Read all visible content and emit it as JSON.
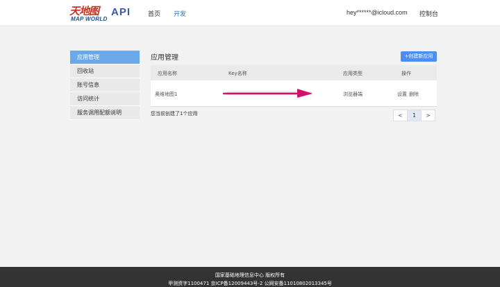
{
  "header": {
    "logo_cn": "天地图",
    "logo_en": "MAP WORLD",
    "api_title": "API",
    "nav_home": "首页",
    "nav_dev": "开发",
    "email": "hey******@icloud.com",
    "console": "控制台"
  },
  "sidebar": {
    "items": [
      {
        "label": "应用管理"
      },
      {
        "label": "回收站"
      },
      {
        "label": "账号信息"
      },
      {
        "label": "访问统计"
      },
      {
        "label": "服务调用配额说明"
      }
    ]
  },
  "main": {
    "title": "应用管理",
    "create_label": "+创建新应用",
    "columns": [
      "应用名称",
      "Key名称",
      "应用类型",
      "操作"
    ],
    "rows": [
      {
        "name": "奥维地图1",
        "type": "浏览器端",
        "action_settings": "设置",
        "action_delete": "删除"
      }
    ],
    "count_text": "您当前创建了1个应用"
  },
  "pagination": {
    "prev": "<",
    "current": "1",
    "next": ">"
  },
  "footer": {
    "line1": "国家基础地理信息中心   版权所有",
    "line2": "甲测资字1100471  京ICP备12009443号-2  公网安备11010802013345号"
  },
  "colors": {
    "accent": "#4c8ff0",
    "sidebar_active": "#6aa8ec",
    "nav_active": "#2a73d1",
    "annotation_arrow": "#d0106a",
    "footer_bg": "#333333"
  }
}
